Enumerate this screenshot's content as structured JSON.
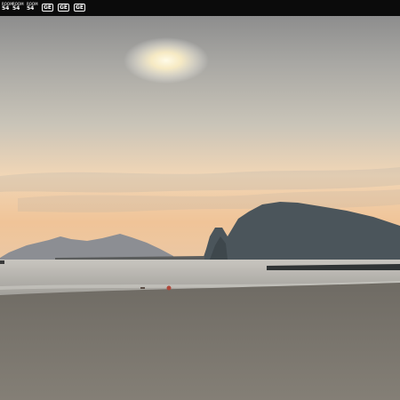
{
  "topbar": {
    "badges": [
      {
        "top": "ROOM",
        "bottom": "54"
      },
      {
        "top": "ROOM",
        "bottom": "54"
      },
      {
        "top": "ROOM",
        "bottom": "54"
      }
    ],
    "boxes": [
      "GE",
      "GE",
      "GE"
    ]
  },
  "colors": {
    "topbar": "#0b0b0b",
    "sky_top": "#8f8f8f",
    "sky_mid": "#c9c3b5",
    "horizon": "#f0c79a",
    "sea": "#a9a9a6",
    "mountain": "#4a5358",
    "sand": "#7d786f"
  }
}
